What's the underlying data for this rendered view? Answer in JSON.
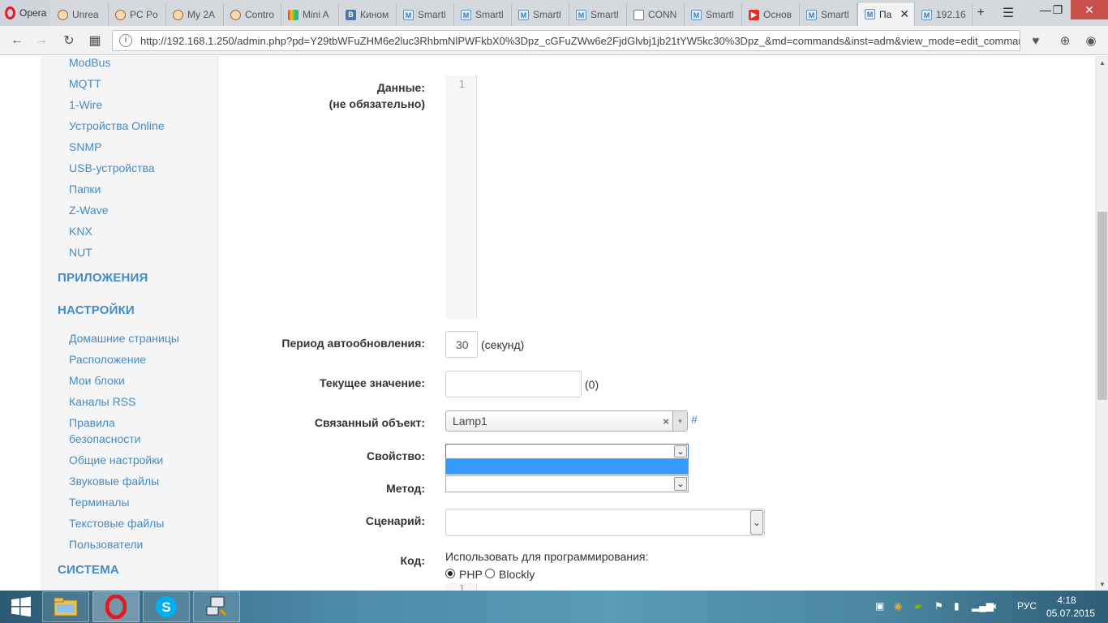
{
  "browser": {
    "menu_label": "Opera",
    "tabs": [
      {
        "label": "Unrea",
        "icon": "monkey-icon"
      },
      {
        "label": "PC Po",
        "icon": "monkey-icon"
      },
      {
        "label": "My 2A",
        "icon": "monkey-icon"
      },
      {
        "label": "Contro",
        "icon": "monkey-icon"
      },
      {
        "label": "Mini A",
        "icon": "color-bars-icon"
      },
      {
        "label": "Кином",
        "icon": "vk-icon"
      },
      {
        "label": "Smartl",
        "icon": "majordomo-icon"
      },
      {
        "label": "Smartl",
        "icon": "majordomo-icon"
      },
      {
        "label": "Smartl",
        "icon": "majordomo-icon"
      },
      {
        "label": "Smartl",
        "icon": "majordomo-icon"
      },
      {
        "label": "CONN",
        "icon": "document-icon"
      },
      {
        "label": "Smartl",
        "icon": "majordomo-icon"
      },
      {
        "label": "Основ",
        "icon": "youtube-icon"
      },
      {
        "label": "Smartl",
        "icon": "majordomo-icon"
      },
      {
        "label": "Па",
        "icon": "majordomo-icon",
        "active": true
      },
      {
        "label": "192.16",
        "icon": "majordomo-icon"
      }
    ],
    "url": "http://192.168.1.250/admin.php?pd=Y29tbWFuZHM6e2luc3RhbmNlPWFkbX0%3Dpz_cGFuZWw6e2FjdGlvbj1jb21tYW5kc30%3Dpz_&md=commands&inst=adm&view_mode=edit_commands"
  },
  "sidebar": {
    "device_links": [
      "ModBus",
      "MQTT",
      "1-Wire",
      "Устройства Online",
      "SNMP",
      "USB-устройства",
      "Папки",
      "Z-Wave",
      "KNX",
      "NUT"
    ],
    "apps_heading": "ПРИЛОЖЕНИЯ",
    "settings_heading": "НАСТРОЙКИ",
    "settings_links": [
      "Домашние страницы",
      "Расположение",
      "Мои блоки",
      "Каналы RSS",
      "Правила",
      "безопасности",
      "Общие настройки",
      "Звуковые файлы",
      "Терминалы",
      "Текстовые файлы",
      "Пользователи"
    ],
    "system_heading": "СИСТЕМА"
  },
  "form": {
    "data_label": "Данные:",
    "data_optional": "(не обязательно)",
    "editor_line": "1",
    "refresh_label": "Период автообновления:",
    "refresh_value": "30",
    "refresh_unit": "(секунд)",
    "current_label": "Текущее значение:",
    "current_value": "",
    "current_hint": "(0)",
    "linked_label": "Связанный объект:",
    "linked_value": "Lamp1",
    "linked_clear": "×",
    "hash": "#",
    "property_label": "Свойство:",
    "property_value": "",
    "method_label": "Метод:",
    "method_value": "",
    "script_label": "Сценарий:",
    "script_value": "",
    "code_label": "Код:",
    "code_hint": "Использовать для программирования:",
    "opt_php": "PHP",
    "opt_blockly": "Blockly",
    "code_editor_line": "1"
  },
  "taskbar": {
    "lang": "РУС",
    "time": "4:18",
    "date": "05.07.2015"
  }
}
